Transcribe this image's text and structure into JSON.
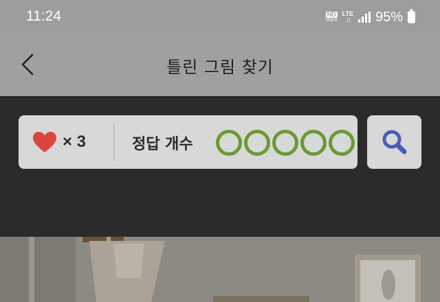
{
  "status_bar": {
    "time": "11:24",
    "hd_label": "HD",
    "voice_label": "Voice",
    "lte_label": "LTE",
    "battery_percent": "95%"
  },
  "header": {
    "back_icon": "chevron-left-icon",
    "title": "틀린 그림 찾기"
  },
  "game_panel": {
    "lives_icon": "heart-icon",
    "lives_text": "× 3",
    "answers_label": "정답 개수",
    "answers_total": 5,
    "answers_found": 0,
    "answer_circle_color": "#6a9a34",
    "heart_color": "#d9463f"
  },
  "hint_button": {
    "icon": "search-icon",
    "icon_color": "#4a5bb8"
  },
  "colors": {
    "dimmed_header": "#a0a0a0",
    "dark_band": "#2b2b2b",
    "panel": "#d8d8d8"
  }
}
